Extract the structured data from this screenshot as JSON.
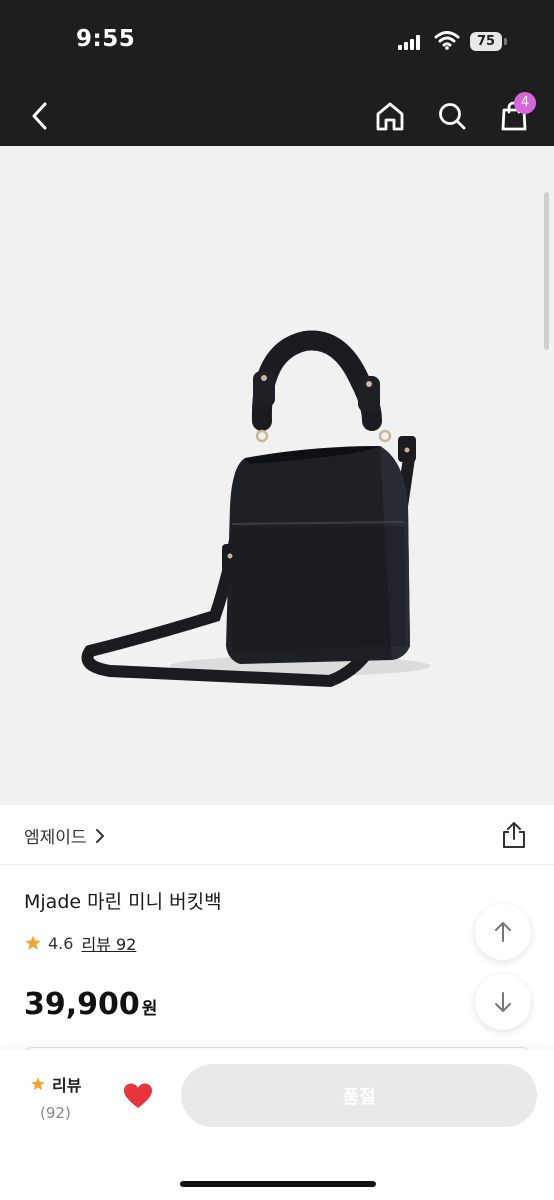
{
  "status_bar": {
    "time": "9:55",
    "battery": "75"
  },
  "header": {
    "back_icon": "chevron-left-icon",
    "home_icon": "home-icon",
    "search_icon": "search-icon",
    "cart_icon": "shopping-bag-icon",
    "cart_badge": "4",
    "badge_color": "#d764d8"
  },
  "product": {
    "brand": "엠제이드",
    "name": "Mjade 마린 미니 버킷백",
    "rating": "4.6",
    "review_link": "리뷰 92",
    "price": "39,900",
    "price_unit": "원"
  },
  "bottom_bar": {
    "review_label": "리뷰",
    "review_count": "(92)",
    "soldout_label": "품절",
    "heart_color": "#e8343c",
    "star_color": "#f3a533"
  }
}
